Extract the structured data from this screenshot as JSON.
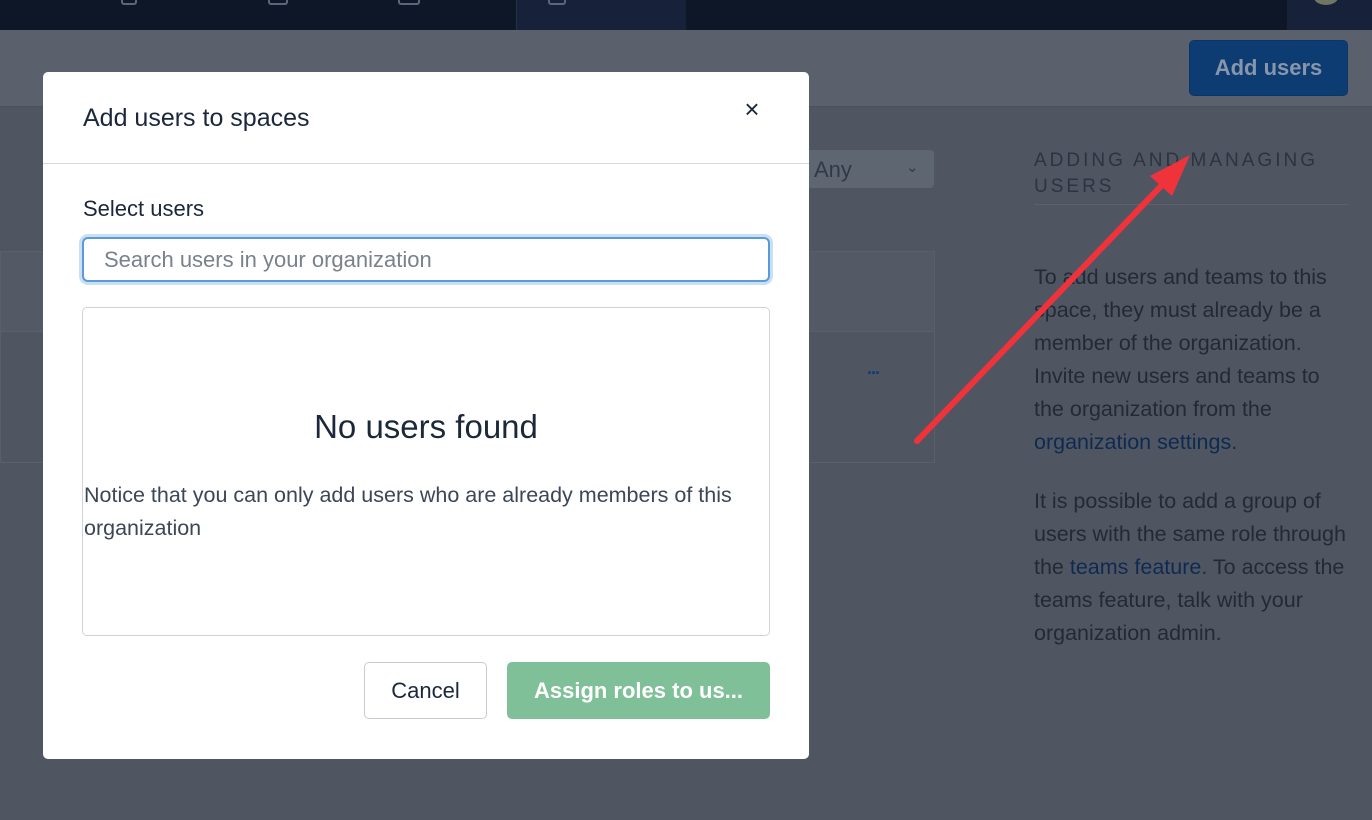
{
  "header": {
    "add_users_label": "Add users"
  },
  "background": {
    "filter_value": "Any",
    "row_menu": "..."
  },
  "help": {
    "title": "ADDING AND MANAGING USERS",
    "para1_text": "To add users and teams to this space, they must already be a member of the organization. Invite new users and teams to the organization from the ",
    "para1_link": "organization settings",
    "para1_end": ".",
    "para2_text": "It is possible to add a group of users with the same role through the ",
    "para2_link": "teams feature",
    "para2_end": ". To access the teams feature, talk with your organization admin."
  },
  "modal": {
    "title": "Add users to spaces",
    "close_label": "×",
    "field_label": "Select users",
    "search_placeholder": "Search users in your organization",
    "search_value": "",
    "empty_title": "No users found",
    "empty_note": "Notice that you can only add users who are already members of this organization",
    "cancel_label": "Cancel",
    "assign_label": "Assign roles to us..."
  },
  "colors": {
    "accent_blue": "#0d3c73",
    "primary_green_disabled": "#7fc099",
    "annotation_red": "#f0333b"
  },
  "icons": [
    "close-icon",
    "chevron-down-icon",
    "annotation-arrow"
  ]
}
